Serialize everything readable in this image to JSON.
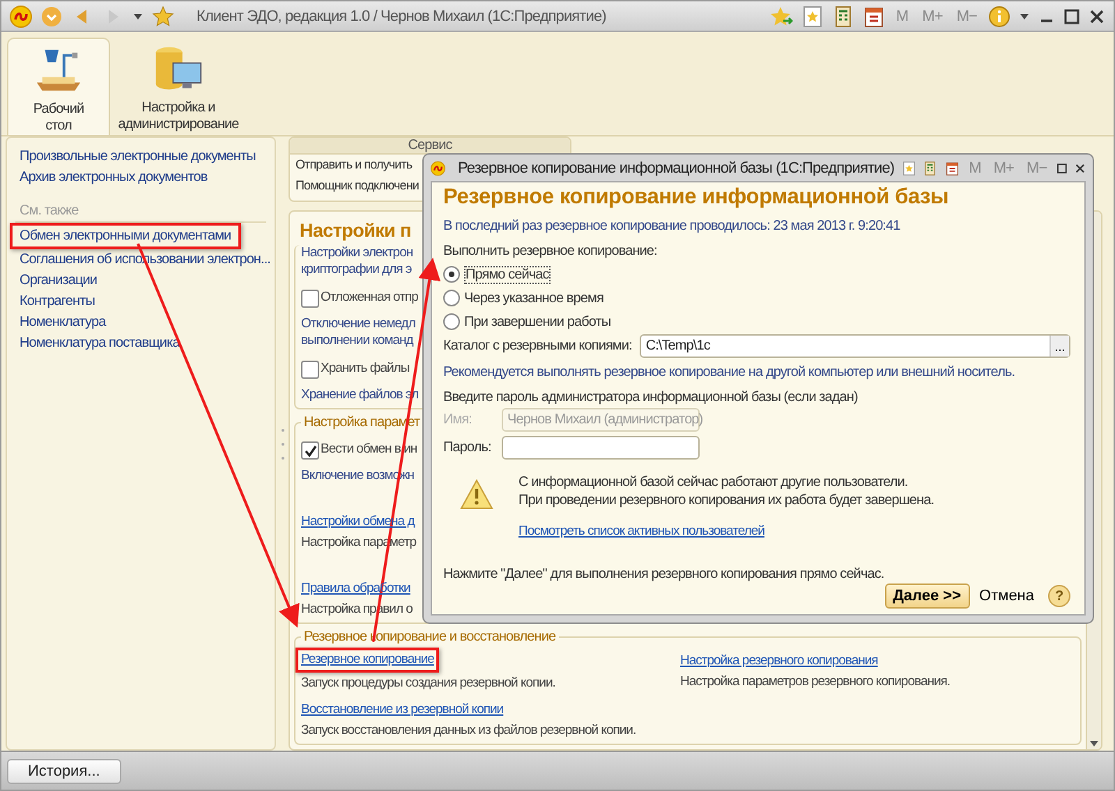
{
  "window": {
    "title": "Клиент ЭДО, редакция 1.0 / Чернов Михаил  (1С:Предприятие)",
    "memory_buttons": [
      {
        "label": "M",
        "disabled": true
      },
      {
        "label": "M+",
        "disabled": true
      },
      {
        "label": "M−",
        "disabled": true
      }
    ]
  },
  "sections": [
    {
      "label": "Рабочий стол",
      "selected": true
    },
    {
      "label": "Настройка и администрирование",
      "selected": false
    }
  ],
  "sidebar": {
    "items": [
      "Произвольные электронные документы",
      "Архив электронных документов"
    ],
    "see_also_title": "См. также",
    "see_also": [
      {
        "label": "Обмен электронными документами",
        "highlighted": true
      },
      {
        "label": "Соглашения об использовании электрон...",
        "highlighted": false
      },
      {
        "label": "Организации",
        "highlighted": false
      },
      {
        "label": "Контрагенты",
        "highlighted": false
      },
      {
        "label": "Номенклатура",
        "highlighted": false
      },
      {
        "label": "Номенклатура поставщика",
        "highlighted": false
      }
    ]
  },
  "service_panel": {
    "title": "Сервис",
    "items": [
      "Отправить и получить",
      "Помощник подключени"
    ]
  },
  "settings": {
    "title": "Настройки п",
    "groups": [
      {
        "columns": [
          [
            {
              "kind": "note",
              "text": "Настройки электрон"
            },
            {
              "kind": "note",
              "text": "криптографии для э"
            },
            {
              "kind": "checkbox",
              "text": "Отложенная отпр",
              "checked": false
            },
            {
              "kind": "note",
              "text": "Отключение немедл"
            },
            {
              "kind": "note",
              "text": "выполнении команд"
            },
            {
              "kind": "checkbox",
              "text": "Хранить файлы",
              "checked": false
            },
            {
              "kind": "note",
              "text": "Хранение файлов эл"
            }
          ]
        ]
      },
      {
        "title": "Настройка парамет",
        "columns": [
          [
            {
              "kind": "checkbox",
              "text": "Вести обмен в ин",
              "checked": true
            },
            {
              "kind": "note",
              "text": "Включение возможн"
            },
            {
              "kind": "link",
              "text": "Настройки обмена д",
              "highlighted": false
            },
            {
              "kind": "text",
              "text": "Настройка параметр"
            },
            {
              "kind": "link",
              "text": "Правила обработки",
              "highlighted": false
            },
            {
              "kind": "text",
              "text": "Настройка правил о"
            }
          ]
        ]
      },
      {
        "title": "Резервное копирование и восстановление",
        "columns": [
          [
            {
              "kind": "link",
              "text": "Резервное копирование",
              "highlighted": true
            },
            {
              "kind": "text",
              "text": "Запуск процедуры создания резервной копии."
            },
            {
              "kind": "link",
              "text": "Восстановление из резервной копии",
              "highlighted": false
            },
            {
              "kind": "text",
              "text": "Запуск восстановления данных из файлов резервной копии."
            }
          ],
          [
            {
              "kind": "link",
              "text": "Настройка резервного копирования",
              "highlighted": false
            },
            {
              "kind": "text",
              "text": "Настройка параметров резервного копирования."
            }
          ]
        ]
      }
    ]
  },
  "dialog": {
    "title": "Резервное копирование информационной базы  (1С:Предприятие)",
    "memory_buttons": [
      {
        "label": "M",
        "disabled": true
      },
      {
        "label": "M+",
        "disabled": true
      },
      {
        "label": "M−",
        "disabled": true
      }
    ],
    "heading": "Резервное копирование информационной базы",
    "last_backup": "В последний раз резервное копирование проводилось: 23 мая 2013 г. 9:20:41",
    "mode_label": "Выполнить резервное копирование:",
    "modes": [
      {
        "label": "Прямо сейчас",
        "selected": true
      },
      {
        "label": "Через указанное время",
        "selected": false
      },
      {
        "label": "При завершении работы",
        "selected": false
      }
    ],
    "catalog": {
      "label": "Каталог с резервными копиями:",
      "value": "C:\\Temp\\1c",
      "button": "..."
    },
    "recommendation": "Рекомендуется выполнять резервное копирование на другой компьютер или внешний носитель.",
    "password_prompt": "Введите пароль администратора информационной базы (если задан)",
    "name_field": {
      "label": "Имя:",
      "value": "Чернов Михаил (администратор)",
      "disabled": true
    },
    "password_field": {
      "label": "Пароль:"
    },
    "warning": [
      "С информационной базой сейчас работают другие пользователи.",
      "При проведении резервного копирования их работа будет завершена."
    ],
    "users_link": "Посмотреть список активных пользователей",
    "hint": "Нажмите \"Далее\" для выполнения резервного копирования прямо сейчас.",
    "buttons": [
      {
        "label": "Далее >>",
        "kind": "primary"
      },
      {
        "label": "Отмена",
        "kind": "flat"
      }
    ],
    "help": "?"
  },
  "history_button": "История..."
}
